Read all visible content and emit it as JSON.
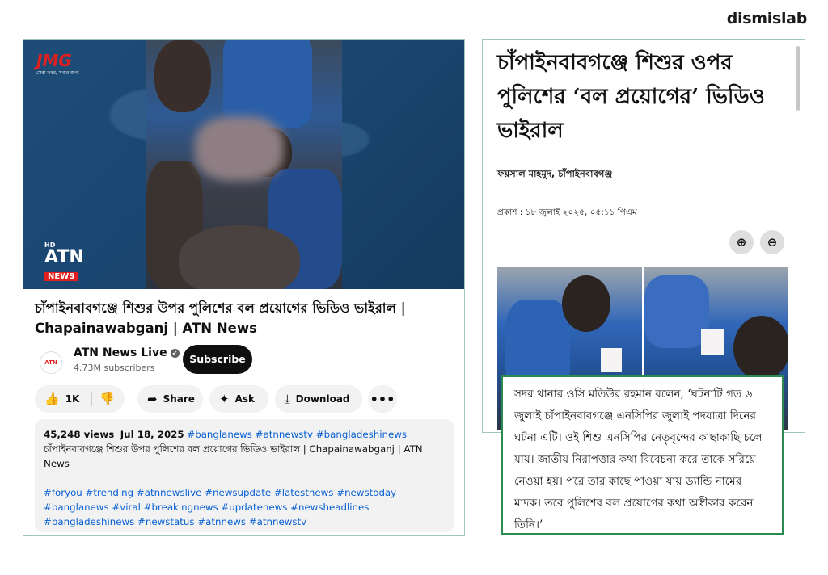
{
  "brand": "dismislab",
  "youtube": {
    "video": {
      "top_logo_text": "JMG",
      "top_logo_tagline": "সেরা খবর, সবার জন্য",
      "bottom_logo_hd": "HD",
      "bottom_logo_name": "ATN",
      "bottom_logo_sub": "NEWS"
    },
    "title": "চাঁপাইনবাবগঞ্জে শিশুর উপর পুলিশের বল প্রয়োগের ভিডিও ভাইরাল | Chapainawabganj | ATN News",
    "channel": {
      "avatar_text": "ATN",
      "name": "ATN News Live",
      "verified_icon": "✔",
      "subscribers": "4.73M subscribers",
      "subscribe_label": "Subscribe"
    },
    "actions": {
      "like_icon": "👍",
      "like_count": "1K",
      "dislike_icon": "👎",
      "share_icon": "➦",
      "share_label": "Share",
      "ask_icon": "✦",
      "ask_label": "Ask",
      "download_icon": "⤓",
      "download_label": "Download",
      "more_icon": "•••"
    },
    "description": {
      "views": "45,248 views",
      "date": "Jul 18, 2025",
      "hashtags_inline": "#banglanews #atnnewstv #bangladeshinews",
      "text": "চাঁপাইনবাবগঞ্জে শিশুর উপর পুলিশের বল প্রয়োগের ভিডিও ভাইরাল | Chapainawabganj | ATN News",
      "tags": "#foryou #trending #atnnewslive #newsupdate #latestnews #newstoday #banglanews #viral #breakingnews #updatenews #newsheadlines #bangladeshinews #newstatus #atnnews #atnnewstv"
    }
  },
  "article": {
    "title": "চাঁপাইনবাবগঞ্জে শিশুর ওপর পুলিশের ‘বল প্রয়োগের’ ভিডিও ভাইরাল",
    "byline": "ফয়সাল মাহমুদ, চাঁপাইনবাবগঞ্জ",
    "published": "প্রকাশ : ১৮ জুলাই ২০২৫, ০৫:১১ পিএম",
    "zoom_in_icon": "⊕",
    "zoom_out_icon": "⊖"
  },
  "quote": "সদর থানার ওসি মতিউর রহমান বলেন, ‘ঘটনাটি গত ৬ জুলাই চাঁপাইনবাবগঞ্জে এনসিপির জুলাই পদযাত্রা দিনের ঘটনা এটি। ওই শিশু এনসিপির নেতৃবৃন্দের কাছাকাছি চলে যায়। জাতীয় নিরাপত্তার কথা বিবেচনা করে তাকে সরিয়ে নেওয়া হয়। পরে তার কাছে পাওয়া যায় ড্যান্ডি নামের মাদক। তবে পুলিশের বল প্রয়োগের কথা অস্বীকার করেন তিনি।’"
}
